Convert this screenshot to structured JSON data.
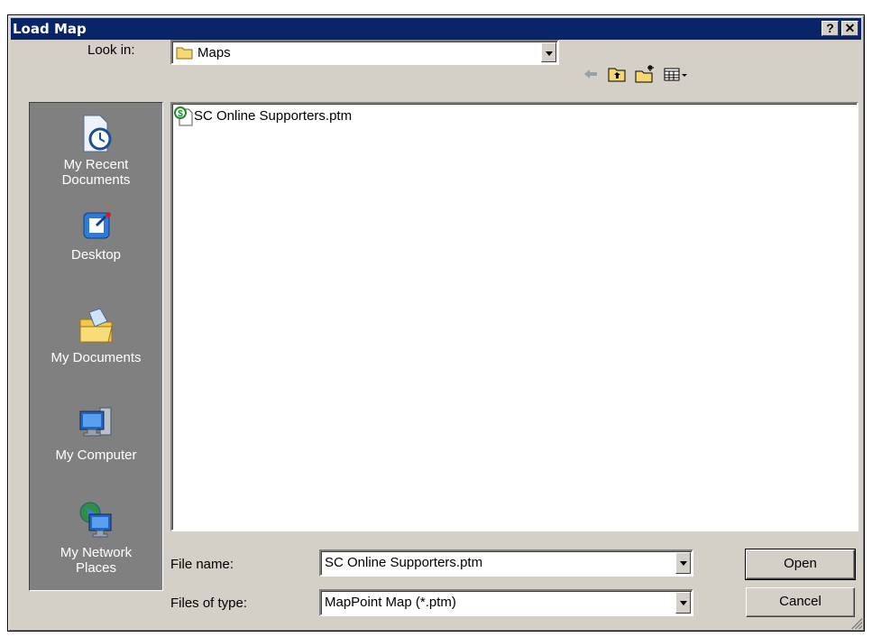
{
  "window": {
    "title": "Load Map",
    "help_label": "?",
    "close_label": "✕"
  },
  "look_in": {
    "label": "Look in:",
    "value": "Maps"
  },
  "toolbar": {
    "back_icon": "back-arrow-icon",
    "up_icon": "up-folder-icon",
    "new_folder_icon": "new-folder-icon",
    "views_icon": "views-menu-icon"
  },
  "places": [
    {
      "label_line1": "My Recent",
      "label_line2": "Documents"
    },
    {
      "label_line1": "Desktop",
      "label_line2": ""
    },
    {
      "label_line1": "My Documents",
      "label_line2": ""
    },
    {
      "label_line1": "My Computer",
      "label_line2": ""
    },
    {
      "label_line1": "My Network",
      "label_line2": "Places"
    }
  ],
  "files": [
    {
      "name": "SC Online Supporters.ptm"
    }
  ],
  "file_name": {
    "label": "File name:",
    "value": "SC Online Supporters.ptm"
  },
  "file_type": {
    "label": "Files of type:",
    "value": "MapPoint Map (*.ptm)"
  },
  "buttons": {
    "open": "Open",
    "cancel": "Cancel"
  },
  "colors": {
    "title_bar": "#0a246a",
    "face": "#d4d0c8",
    "places_bar": "#808080"
  }
}
